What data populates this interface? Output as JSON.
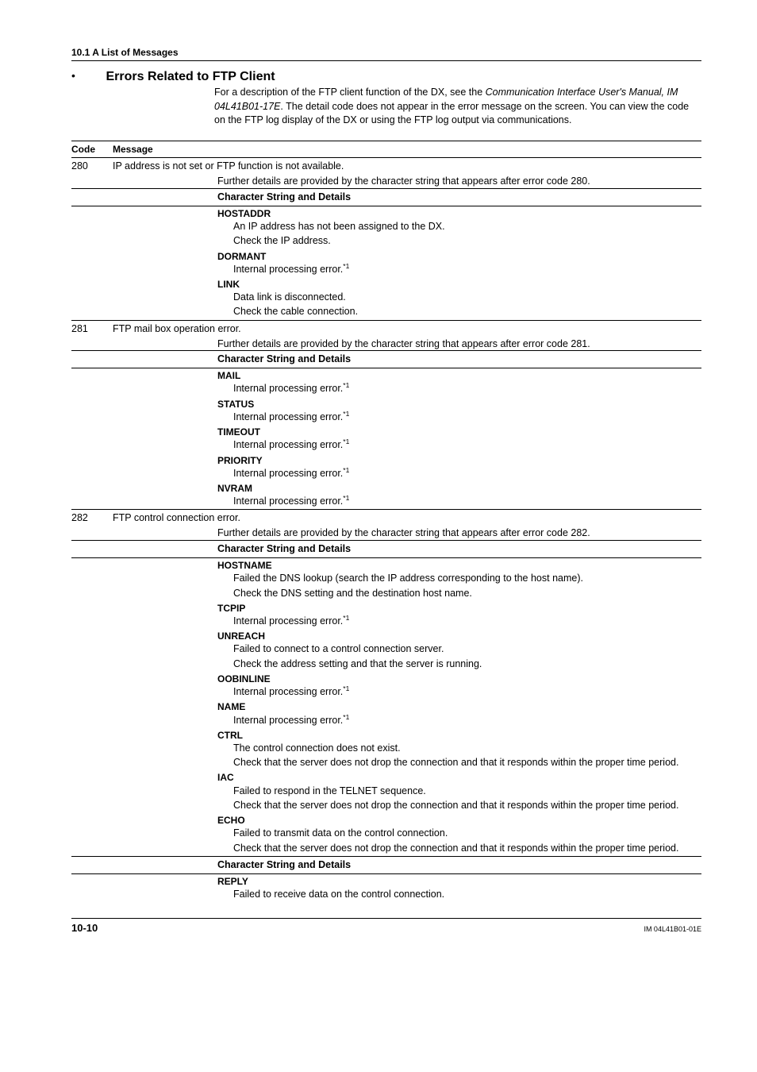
{
  "header": "10.1  A List of Messages",
  "section": {
    "bullet": "•",
    "title": "Errors Related to FTP Client",
    "intro": "For a description of the FTP client function of the DX, see the Communication Interface User's Manual, IM 04L41B01-17E. The detail code does not appear in the error message on the screen. You can view the code on the FTP log display of the DX or using the FTP log output via communications.",
    "intro_italic1": "Communication Interface User's Manual, IM 04L41B01-17E"
  },
  "table": {
    "head_code": "Code",
    "head_msg": "Message",
    "csd": "Character String and Details",
    "rows": [
      {
        "code": "280",
        "message": "IP address is not set or FTP function is not available.",
        "note": "Further details are provided by the character string that appears after error code 280.",
        "items": [
          {
            "key": "HOSTADDR",
            "lines": [
              "An IP address has not been assigned to the DX.",
              "Check the IP address."
            ]
          },
          {
            "key": "DORMANT",
            "lines": [
              "Internal processing error."
            ],
            "sup": "*1"
          },
          {
            "key": "LINK",
            "lines": [
              "Data link is disconnected.",
              "Check the cable connection."
            ]
          }
        ]
      },
      {
        "code": "281",
        "message": "FTP mail box operation error.",
        "note": "Further details are provided by the character string that appears after error code 281.",
        "items": [
          {
            "key": "MAIL",
            "lines": [
              "Internal processing error."
            ],
            "sup": "*1"
          },
          {
            "key": "STATUS",
            "lines": [
              "Internal processing error."
            ],
            "sup": "*1"
          },
          {
            "key": "TIMEOUT",
            "lines": [
              "Internal processing error."
            ],
            "sup": "*1"
          },
          {
            "key": "PRIORITY",
            "lines": [
              "Internal processing error."
            ],
            "sup": "*1"
          },
          {
            "key": "NVRAM",
            "lines": [
              "Internal processing error."
            ],
            "sup": "*1"
          }
        ]
      },
      {
        "code": "282",
        "message": "FTP control connection error.",
        "note": "Further details are provided by the character string that appears after error code 282.",
        "items": [
          {
            "key": "HOSTNAME",
            "lines": [
              "Failed the DNS lookup (search the IP address corresponding to the host name).",
              "Check the DNS setting and the destination host name."
            ]
          },
          {
            "key": "TCPIP",
            "lines": [
              "Internal processing error."
            ],
            "sup": "*1"
          },
          {
            "key": "UNREACH",
            "lines": [
              "Failed to connect to a control connection server.",
              "Check the address setting and that the server is running."
            ]
          },
          {
            "key": "OOBINLINE",
            "lines": [
              "Internal processing error."
            ],
            "sup": "*1"
          },
          {
            "key": "NAME",
            "lines": [
              "Internal processing error."
            ],
            "sup": "*1"
          },
          {
            "key": "CTRL",
            "lines": [
              "The control connection does not exist.",
              "Check that the server does not drop the connection and that it responds within the proper time period."
            ]
          },
          {
            "key": "IAC",
            "lines": [
              "Failed to respond in the TELNET sequence.",
              "Check that the server does not drop the connection and that it responds within the proper time period."
            ]
          },
          {
            "key": "ECHO",
            "lines": [
              "Failed to transmit data on the control connection.",
              "Check that the server does not drop the connection and that it responds within the proper time period."
            ]
          }
        ],
        "extra_csd": true,
        "extra_items": [
          {
            "key": "REPLY",
            "lines": [
              "Failed to receive data on the control connection."
            ]
          }
        ]
      }
    ]
  },
  "footer": {
    "page": "10-10",
    "doc": "IM 04L41B01-01E"
  }
}
